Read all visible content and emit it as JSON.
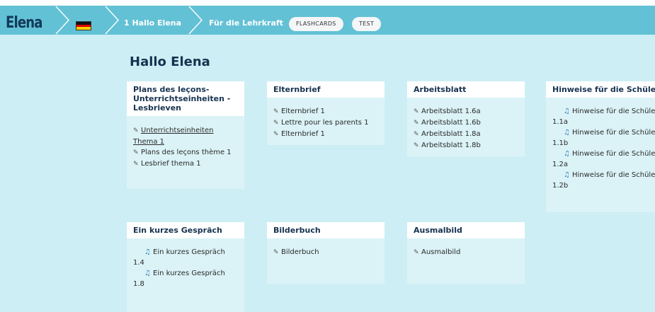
{
  "nav": {
    "brand": "Elena",
    "crumbs": [
      "1 Hallo Elena",
      "Für die Lehrkraft"
    ],
    "pills": [
      "FLASHCARDS",
      "TEST"
    ]
  },
  "page": {
    "title": "Hallo Elena"
  },
  "cards_row1": [
    {
      "title": "Plans des leçons-Unterrichtseinheiten - Lesbrieven",
      "items": [
        "Unterrichtseinheiten Thema 1",
        "Plans des leçons thème 1",
        "Lesbrief thema 1"
      ]
    },
    {
      "title": "Elternbrief",
      "items": [
        "Elternbrief 1",
        "Lettre pour les parents 1",
        "Elternbrief 1"
      ]
    },
    {
      "title": "Arbeitsblatt",
      "items": [
        "Arbeitsblatt 1.6a",
        "Arbeitsblatt 1.6b",
        "Arbeitsblatt 1.8a",
        "Arbeitsblatt 1.8b"
      ]
    },
    {
      "title": "Hinweise für die Schüler",
      "items": [
        [
          "Hinweise für die Schüler",
          "1.1a"
        ],
        [
          "Hinweise für die Schüler",
          "1.1b"
        ],
        [
          "Hinweise für die Schüler",
          "1.2a"
        ],
        [
          "Hinweise für die Schüler",
          "1.2b"
        ]
      ]
    }
  ],
  "cards_row2": [
    {
      "title": "Ein kurzes Gespräch",
      "items": [
        [
          "Ein kurzes Gespräch",
          "1.4"
        ],
        [
          "Ein kurzes Gespräch",
          "1.8"
        ]
      ]
    },
    {
      "title": "Bilderbuch",
      "items": [
        "Bilderbuch"
      ]
    },
    {
      "title": "Ausmalbild",
      "items": [
        "Ausmalbild"
      ]
    }
  ],
  "icons": {
    "pencil": "pencil-icon",
    "music": "music-note-icon"
  },
  "colors": {
    "nav": "#62c1d5",
    "background": "#cdeef4",
    "card_body": "#dbf3f7",
    "title": "#16324f"
  }
}
